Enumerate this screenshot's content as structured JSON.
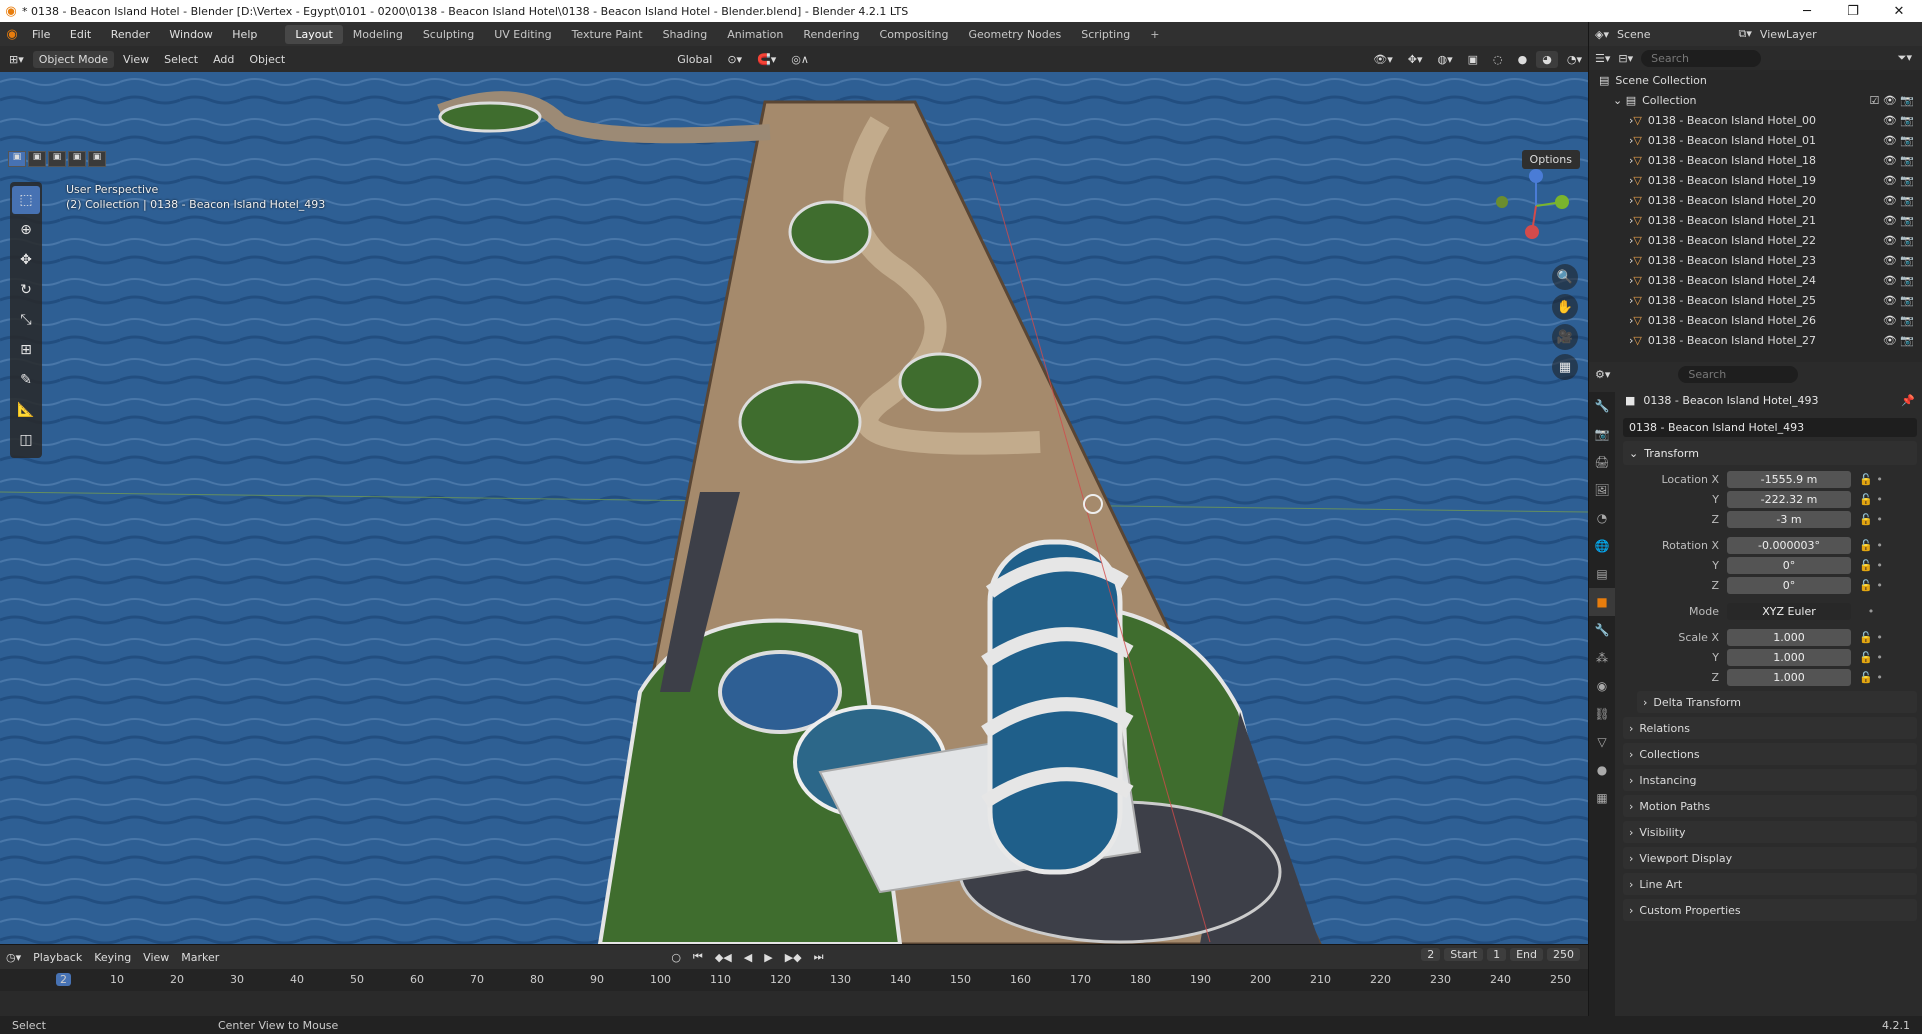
{
  "window": {
    "title": "* 0138 - Beacon Island Hotel - Blender [D:\\Vertex - Egypt\\0101 - 0200\\0138 - Beacon Island Hotel\\0138 - Beacon Island Hotel - Blender.blend] - Blender 4.2.1 LTS",
    "minimize": "─",
    "maximize": "❐",
    "close": "✕"
  },
  "menu": [
    "File",
    "Edit",
    "Render",
    "Window",
    "Help"
  ],
  "workspaces": [
    "Layout",
    "Modeling",
    "Sculpting",
    "UV Editing",
    "Texture Paint",
    "Shading",
    "Animation",
    "Rendering",
    "Compositing",
    "Geometry Nodes",
    "Scripting"
  ],
  "viewport": {
    "mode": "Object Mode",
    "menus": [
      "View",
      "Select",
      "Add",
      "Object"
    ],
    "orientation": "Global",
    "options": "Options",
    "info1": "User Perspective",
    "info2": "(2) Collection | 0138 - Beacon Island Hotel_493"
  },
  "outliner": {
    "scene": "Scene",
    "view_layer": "ViewLayer",
    "search": "Search",
    "root": "Scene Collection",
    "collection": "Collection",
    "items": [
      "0138 - Beacon Island Hotel_00",
      "0138 - Beacon Island Hotel_01",
      "0138 - Beacon Island Hotel_18",
      "0138 - Beacon Island Hotel_19",
      "0138 - Beacon Island Hotel_20",
      "0138 - Beacon Island Hotel_21",
      "0138 - Beacon Island Hotel_22",
      "0138 - Beacon Island Hotel_23",
      "0138 - Beacon Island Hotel_24",
      "0138 - Beacon Island Hotel_25",
      "0138 - Beacon Island Hotel_26",
      "0138 - Beacon Island Hotel_27"
    ]
  },
  "properties": {
    "search": "Search",
    "object_name": "0138 - Beacon Island Hotel_493",
    "transform": "Transform",
    "location_x": "-1555.9 m",
    "location_y": "-222.32 m",
    "location_z": "-3 m",
    "rotation_x": "-0.000003°",
    "rotation_y": "0°",
    "rotation_z": "0°",
    "mode": "XYZ Euler",
    "scale_x": "1.000",
    "scale_y": "1.000",
    "scale_z": "1.000",
    "labels": {
      "loc": "Location X",
      "rot": "Rotation X",
      "mode": "Mode",
      "scale": "Scale X",
      "y": "Y",
      "z": "Z"
    },
    "sections": [
      "Delta Transform",
      "Relations",
      "Collections",
      "Instancing",
      "Motion Paths",
      "Visibility",
      "Viewport Display",
      "Line Art",
      "Custom Properties"
    ]
  },
  "timeline": {
    "menus": [
      "Playback",
      "Keying",
      "View",
      "Marker"
    ],
    "current": "2",
    "start_label": "Start",
    "start": "1",
    "end_label": "End",
    "end": "250",
    "ticks": [
      "10",
      "20",
      "30",
      "40",
      "50",
      "60",
      "70",
      "80",
      "90",
      "100",
      "110",
      "120",
      "130",
      "140",
      "150",
      "160",
      "170",
      "180",
      "190",
      "200",
      "210",
      "220",
      "230",
      "240",
      "250"
    ]
  },
  "status": {
    "select": "Select",
    "center": "Center View to Mouse",
    "version": "4.2.1"
  }
}
